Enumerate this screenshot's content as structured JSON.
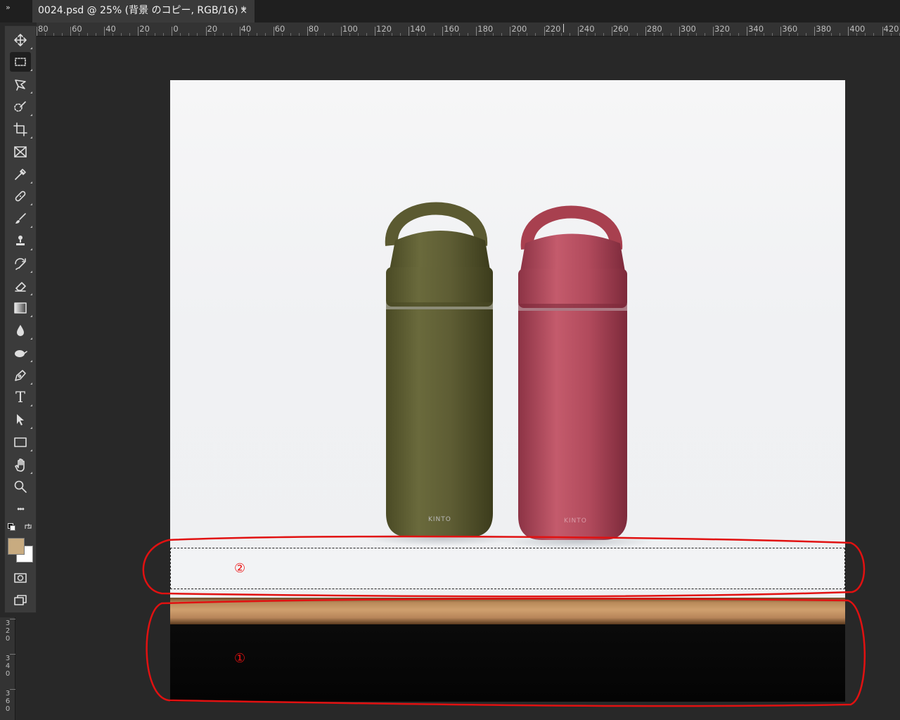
{
  "tab": {
    "collapse_glyph": "»",
    "title": "0024.psd @ 25% (背景 のコピー, RGB/16) *",
    "close_glyph": "×"
  },
  "ruler": {
    "h_labels": [
      "80",
      "60",
      "40",
      "20",
      "0",
      "20",
      "40",
      "60",
      "80",
      "100",
      "120",
      "140",
      "160",
      "180",
      "200",
      "220",
      "240",
      "260",
      "280",
      "300",
      "320",
      "340",
      "360",
      "380",
      "400",
      "420"
    ],
    "v_labels": [
      {
        "digits": [
          "3",
          "2",
          "0"
        ]
      },
      {
        "digits": [
          "3",
          "4",
          "0"
        ]
      },
      {
        "digits": [
          "3",
          "6",
          "0"
        ]
      }
    ]
  },
  "toolbar": {
    "tools": [
      {
        "name": "move-tool",
        "icon": "move-icon"
      },
      {
        "name": "rectangular-marquee-tool",
        "icon": "marquee-icon",
        "active": true
      },
      {
        "name": "lasso-tool",
        "icon": "lasso-icon"
      },
      {
        "name": "quick-selection-tool",
        "icon": "quick-selection-icon"
      },
      {
        "name": "crop-tool",
        "icon": "crop-icon"
      },
      {
        "name": "frame-tool",
        "icon": "frame-icon"
      },
      {
        "name": "eyedropper-tool",
        "icon": "eyedropper-icon"
      },
      {
        "name": "healing-brush-tool",
        "icon": "bandage-icon"
      },
      {
        "name": "brush-tool",
        "icon": "brush-icon"
      },
      {
        "name": "clone-stamp-tool",
        "icon": "stamp-icon"
      },
      {
        "name": "history-brush-tool",
        "icon": "history-brush-icon"
      },
      {
        "name": "eraser-tool",
        "icon": "eraser-icon"
      },
      {
        "name": "gradient-tool",
        "icon": "gradient-icon"
      },
      {
        "name": "blur-tool",
        "icon": "drop-icon"
      },
      {
        "name": "dodge-tool",
        "icon": "dodge-icon"
      },
      {
        "name": "pen-tool",
        "icon": "pen-icon"
      },
      {
        "name": "type-tool",
        "icon": "type-icon",
        "glyph": "T"
      },
      {
        "name": "path-selection-tool",
        "icon": "arrow-icon"
      },
      {
        "name": "rectangle-tool",
        "icon": "rectangle-icon"
      },
      {
        "name": "hand-tool",
        "icon": "hand-icon"
      },
      {
        "name": "zoom-tool",
        "icon": "zoom-icon"
      },
      {
        "name": "edit-toolbar",
        "icon": "more-icon",
        "glyph": "•••"
      }
    ],
    "foreground_color": "#c8ab80",
    "background_color": "#ffffff"
  },
  "canvas": {
    "bottle_label_left": "KINTO",
    "bottle_label_right": "KINTO",
    "bottle_colors": {
      "left": "#5e5d34",
      "right": "#b14a5c"
    },
    "annotations": [
      {
        "label": "①",
        "color": "#e11111"
      },
      {
        "label": "②",
        "color": "#e11111"
      }
    ]
  }
}
